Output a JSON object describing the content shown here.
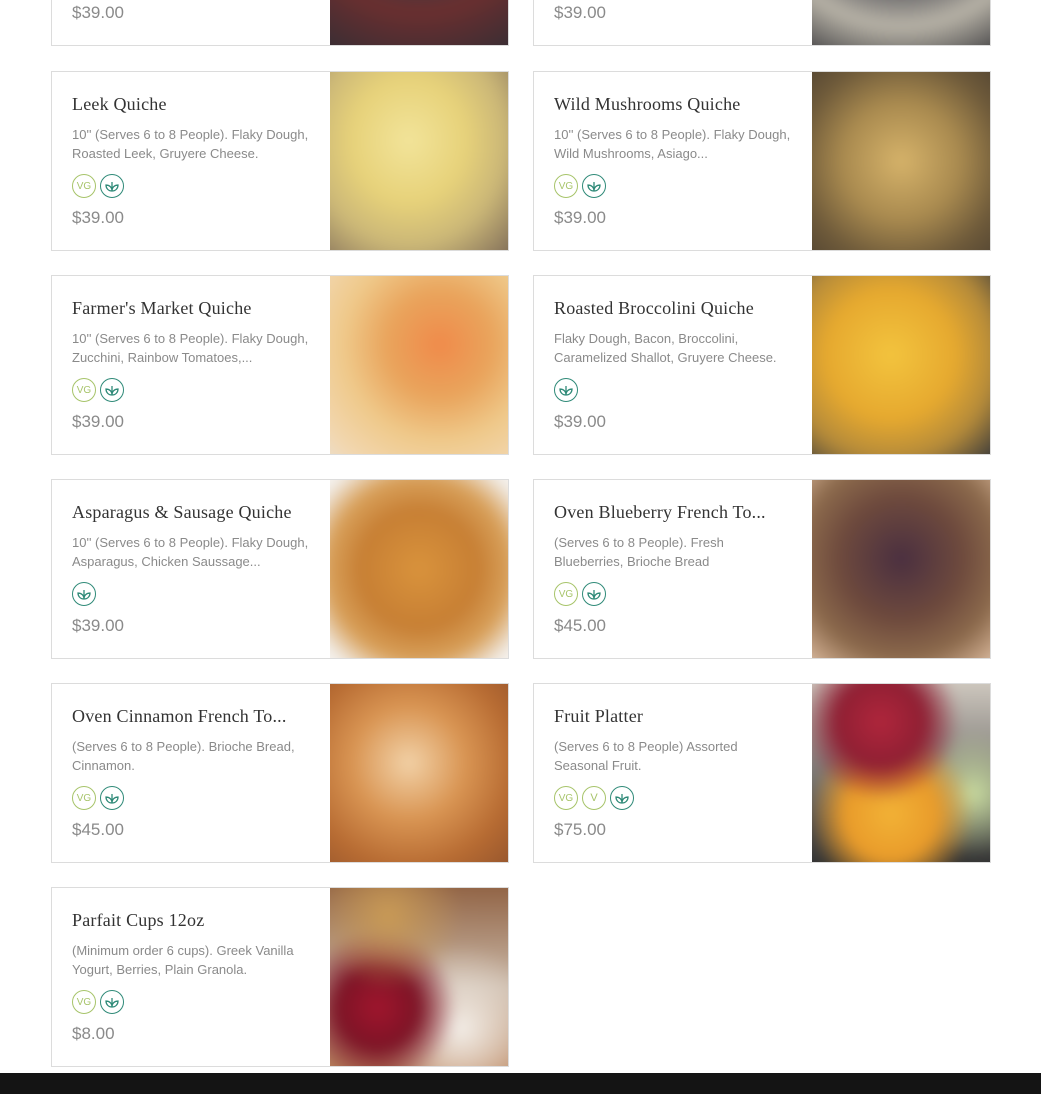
{
  "menu_items": [
    {
      "id": "top-left-partial",
      "title": "",
      "description": "",
      "badges": [],
      "price": "$39.00",
      "image": "quiche-image",
      "partial": true
    },
    {
      "id": "top-right-partial",
      "title": "",
      "description": "",
      "badges": [],
      "price": "$39.00",
      "image": "quiche-image",
      "partial": true
    },
    {
      "id": "leek",
      "title": "Leek Quiche",
      "description": "10'' (Serves 6 to 8 People). Flaky Dough, Roasted Leek, Gruyere Cheese.",
      "badges": [
        "VG",
        "leaf"
      ],
      "price": "$39.00",
      "image": "leek-quiche-image"
    },
    {
      "id": "wild-mushrooms",
      "title": "Wild Mushrooms Quiche",
      "description": "10'' (Serves 6 to 8 People). Flaky Dough, Wild Mushrooms, Asiago...",
      "badges": [
        "VG",
        "leaf"
      ],
      "price": "$39.00",
      "image": "wild-mushrooms-quiche-image"
    },
    {
      "id": "farmers-market",
      "title": "Farmer's Market Quiche",
      "description": "10'' (Serves 6 to 8 People). Flaky Dough, Zucchini, Rainbow Tomatoes,...",
      "badges": [
        "VG",
        "leaf"
      ],
      "price": "$39.00",
      "image": "farmers-market-quiche-image"
    },
    {
      "id": "roasted-broccolini",
      "title": "Roasted Broccolini Quiche",
      "description": "Flaky Dough, Bacon, Broccolini, Caramelized Shallot, Gruyere Cheese.",
      "badges": [
        "leaf"
      ],
      "price": "$39.00",
      "image": "roasted-broccolini-quiche-image"
    },
    {
      "id": "asparagus-sausage",
      "title": "Asparagus & Sausage Quiche",
      "description": "10'' (Serves 6 to 8 People). Flaky Dough, Asparagus, Chicken Saussage...",
      "badges": [
        "leaf"
      ],
      "price": "$39.00",
      "image": "asparagus-sausage-quiche-image"
    },
    {
      "id": "oven-blueberry",
      "title": "Oven Blueberry French To...",
      "description": "(Serves 6 to 8 People). Fresh Blueberries, Brioche Bread",
      "badges": [
        "VG",
        "leaf"
      ],
      "price": "$45.00",
      "image": "oven-blueberry-french-toast-image"
    },
    {
      "id": "oven-cinnamon",
      "title": "Oven Cinnamon French To...",
      "description": "(Serves 6 to 8 People). Brioche Bread, Cinnamon.",
      "badges": [
        "VG",
        "leaf"
      ],
      "price": "$45.00",
      "image": "oven-cinnamon-french-toast-image"
    },
    {
      "id": "fruit-platter",
      "title": "Fruit Platter",
      "description": "(Serves 6 to 8 People) Assorted Seasonal Fruit.",
      "badges": [
        "VG",
        "V",
        "leaf"
      ],
      "price": "$75.00",
      "image": "fruit-platter-image"
    },
    {
      "id": "parfait-cups",
      "title": "Parfait Cups 12oz",
      "description": "(Minimum order 6 cups). Greek Vanilla Yogurt, Berries, Plain Granola.",
      "badges": [
        "VG",
        "leaf"
      ],
      "price": "$8.00",
      "image": "parfait-cups-image"
    }
  ],
  "colors": {
    "vg_badge": "#a7c46a",
    "leaf_badge": "#2f8a78",
    "border": "#dcdcdc",
    "title": "#333333",
    "muted_text": "#8a8a8a",
    "footer_bar": "#141414"
  }
}
